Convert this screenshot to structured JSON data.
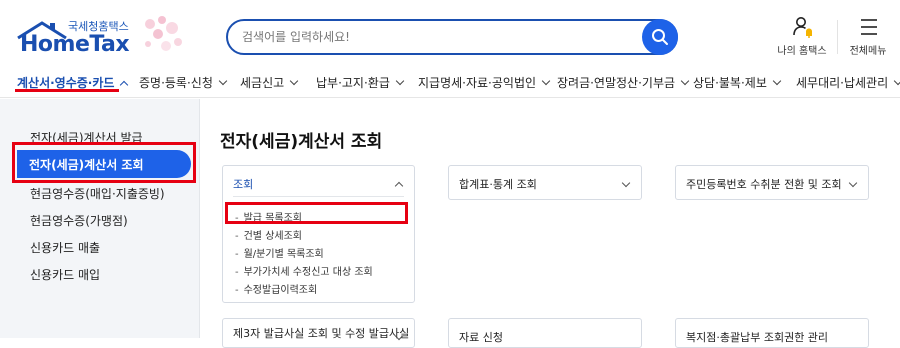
{
  "header": {
    "logo_sub": "국세청홈택스",
    "logo_main": "HomeTax",
    "search_placeholder": "검색어를 입력하세요!",
    "my_hometax": "나의 홈택스",
    "all_menu": "전체메뉴"
  },
  "gnb": [
    {
      "label": "계산서·영수증·카드",
      "active": true
    },
    {
      "label": "증명·등록·신청"
    },
    {
      "label": "세금신고"
    },
    {
      "label": "납부·고지·환급"
    },
    {
      "label": "지급명세·자료·공익법인"
    },
    {
      "label": "장려금·연말정산·기부금"
    },
    {
      "label": "상담·불복·제보"
    },
    {
      "label": "세무대리·납세관리"
    }
  ],
  "sidebar": {
    "items": [
      {
        "label": "전자(세금)계산서 발급"
      },
      {
        "label": "전자(세금)계산서 조회",
        "active": true
      },
      {
        "label": "현금영수증(매입·지출증빙)"
      },
      {
        "label": "현금영수증(가맹점)"
      },
      {
        "label": "신용카드 매출"
      },
      {
        "label": "신용카드 매입"
      }
    ]
  },
  "main": {
    "title": "전자(세금)계산서 조회",
    "cards": [
      {
        "title": "조회",
        "expanded": true,
        "items": [
          "발급 목록조회",
          "건별 상세조회",
          "월/분기별 목록조회",
          "부가가치세 수정신고 대상 조회",
          "수정발급이력조회"
        ]
      },
      {
        "title": "합계표·통계 조회"
      },
      {
        "title": "주민등록번호 수취분 전환 및 조회"
      },
      {
        "title": "제3자 발급사실 조회 및 수정 발급사실"
      },
      {
        "title": "자료 신청"
      },
      {
        "title": "복지점·총괄납부 조회권한 관리"
      }
    ]
  },
  "colors": {
    "brand": "#1a4fb0",
    "accent": "#1e62e8",
    "highlight": "#e60012"
  }
}
